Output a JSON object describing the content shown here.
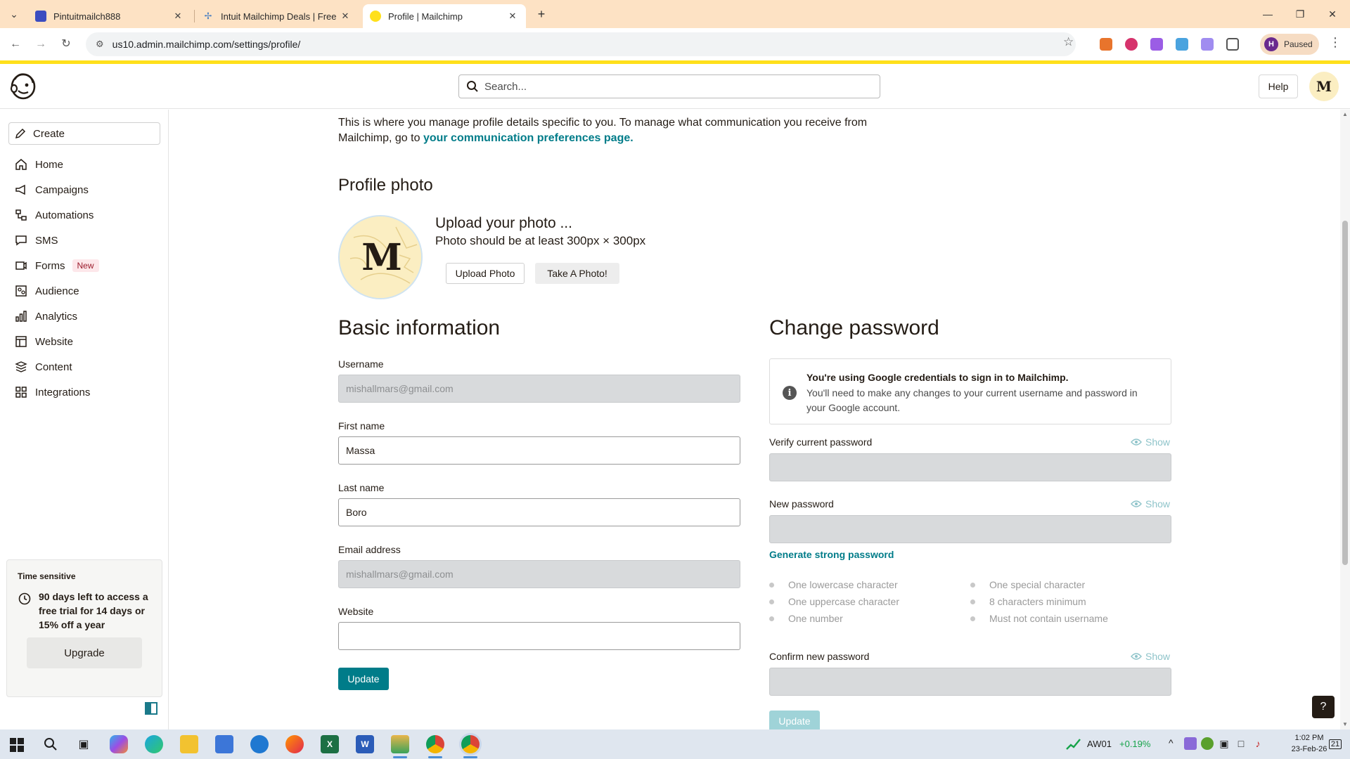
{
  "browser": {
    "tabs": [
      {
        "label": "Pintuitmailch888",
        "active": false
      },
      {
        "label": "Intuit Mailchimp Deals | Free Tri",
        "active": false
      },
      {
        "label": "Profile | Mailchimp",
        "active": true
      }
    ],
    "url": "us10.admin.mailchimp.com/settings/profile/",
    "profile_initial": "H",
    "profile_status": "Paused"
  },
  "header": {
    "search_placeholder": "Search...",
    "help_label": "Help",
    "avatar_initial": "M"
  },
  "sidebar": {
    "create_label": "Create",
    "items": [
      {
        "label": "Home",
        "icon": "home-icon"
      },
      {
        "label": "Campaigns",
        "icon": "megaphone-icon"
      },
      {
        "label": "Automations",
        "icon": "flow-icon"
      },
      {
        "label": "SMS",
        "icon": "sms-icon"
      },
      {
        "label": "Forms",
        "icon": "form-icon",
        "badge": "New"
      },
      {
        "label": "Audience",
        "icon": "people-icon"
      },
      {
        "label": "Analytics",
        "icon": "bar-chart-icon"
      },
      {
        "label": "Website",
        "icon": "website-icon"
      },
      {
        "label": "Content",
        "icon": "content-icon"
      },
      {
        "label": "Integrations",
        "icon": "grid-icon"
      }
    ],
    "time_sensitive": {
      "title": "Time sensitive",
      "text": "90 days left to access a free trial for 14 days or 15% off a year",
      "button": "Upgrade"
    }
  },
  "main": {
    "intro_text": "This is where you manage profile details specific to you. To manage what communication you receive from Mailchimp, go to ",
    "intro_link": "your communication preferences page.",
    "profile_photo": {
      "heading": "Profile photo",
      "avatar_letter": "M",
      "upload_title": "Upload your photo ...",
      "upload_hint": "Photo should be at least 300px × 300px",
      "upload_button": "Upload Photo",
      "take_button": "Take A Photo!"
    },
    "basic": {
      "heading": "Basic information",
      "username_label": "Username",
      "username_value": "mishallmars@gmail.com",
      "first_name_label": "First name",
      "first_name_value": "Massa",
      "last_name_label": "Last name",
      "last_name_value": "Boro",
      "email_label": "Email address",
      "email_value": "mishallmars@gmail.com",
      "website_label": "Website",
      "website_value": "",
      "update_button": "Update"
    },
    "password": {
      "heading": "Change password",
      "notice_title": "You're using Google credentials to sign in to Mailchimp.",
      "notice_body": "You'll need to make any changes to your current username and password in your Google account.",
      "verify_label": "Verify current password",
      "new_label": "New password",
      "confirm_label": "Confirm new password",
      "show_label": "Show",
      "generate_link": "Generate strong password",
      "rules_left": [
        "One lowercase character",
        "One uppercase character",
        "One number"
      ],
      "rules_right": [
        "One special character",
        "8 characters minimum",
        "Must not contain username"
      ],
      "update_button": "Update"
    }
  },
  "taskbar": {
    "ticker_name": "AW01",
    "ticker_change": "+0.19%",
    "time": "1:02 PM",
    "date": "23-Feb-26",
    "notification_count": "21"
  },
  "colors": {
    "accent": "#007c89",
    "brand_yellow": "#ffe01b",
    "tab_bar": "#fde2c4"
  }
}
